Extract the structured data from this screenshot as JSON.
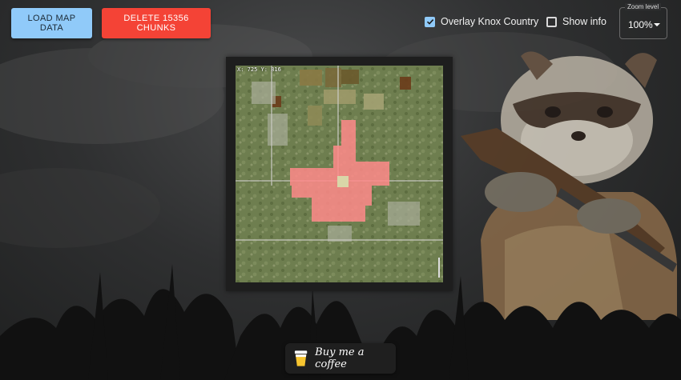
{
  "toolbar": {
    "load_label": "LOAD MAP DATA",
    "delete_label": "DELETE 15356 CHUNKS"
  },
  "options": {
    "overlay_label": "Overlay Knox Country",
    "overlay_checked": true,
    "show_info_label": "Show info",
    "show_info_checked": false
  },
  "zoom": {
    "legend": "Zoom level",
    "value": "100%"
  },
  "map": {
    "coords": "X: 725  Y: 816"
  },
  "coffee": {
    "label": "Buy me a coffee"
  },
  "colors": {
    "load_button": "#90caf9",
    "delete_button": "#f44336",
    "checkbox_accent": "#90caf9",
    "selection_overlay": "#ff8a8a"
  },
  "icons": {
    "checkbox_checked": "check-icon",
    "dropdown": "caret-down-icon",
    "coffee": "coffee-cup-icon"
  }
}
